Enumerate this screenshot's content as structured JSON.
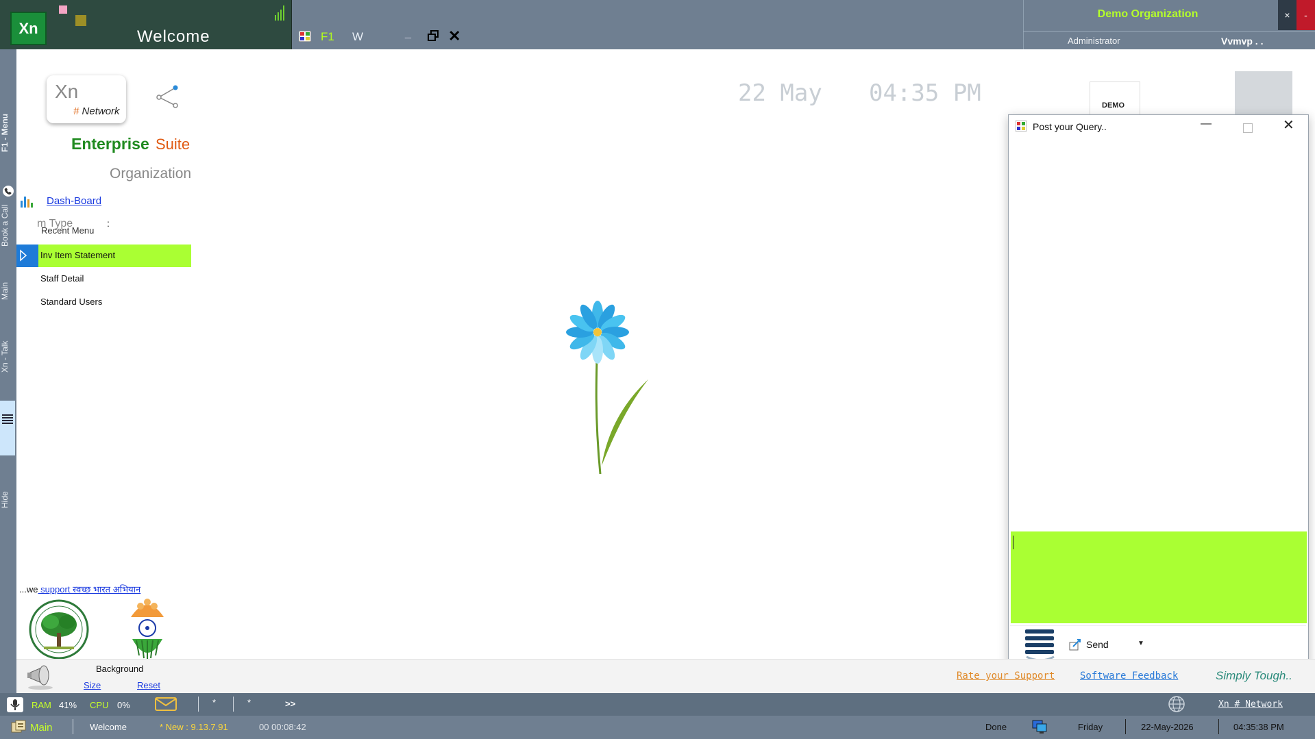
{
  "titlebar": {
    "logo_text": "Xn",
    "title": "Welcome",
    "f1_label": "F1",
    "w_label": "W",
    "min_glyph": "_",
    "close_glyph": "✕"
  },
  "org": {
    "name": "Demo Organization",
    "close_glyph": "×",
    "min_glyph": "-",
    "role": "Administrator",
    "user": "Vvmvp . ."
  },
  "vertical_tabs": {
    "f1_menu": "F1 - Menu",
    "book_call": "Book a Call",
    "main": "Main",
    "xn_talk": "Xn - Talk",
    "hide": "Hide"
  },
  "left_panel": {
    "card_xn": "Xn",
    "card_hash": "#",
    "card_network": "Network",
    "enterprise": "Enterprise",
    "suite": "Suite",
    "organization": "Organization",
    "dashboard": "Dash-Board",
    "type_ghost": "m Type",
    "colon": ":",
    "recent_menu": "Recent Menu",
    "menu_items": [
      "Inv Item Statement",
      "Staff Detail",
      "Standard Users"
    ],
    "swachh_prefix": "...we",
    "swachh_link": " support स्वच्छ भारत अभियान"
  },
  "clock": {
    "date": "22 May",
    "time": "04:35 PM"
  },
  "demo_logo_text": "DEMO",
  "dialog": {
    "title": "Post your Query..",
    "min_glyph": "—",
    "close_glyph": "✕",
    "send_label": "Send",
    "send_caret": "▼"
  },
  "bottom_links": {
    "background": "Background",
    "size": "Size",
    "reset": "Reset",
    "rate": "Rate your Support",
    "feedback": "Software Feedback",
    "tagline": "Simply Tough.."
  },
  "status1": {
    "ram_label": "RAM",
    "ram_value": "41%",
    "cpu_label": "CPU",
    "cpu_value": "0%",
    "star1": "*",
    "star2": "*",
    "more": ">>",
    "xn_network": "Xn # Network"
  },
  "status2": {
    "main": "Main",
    "welcome": "Welcome",
    "version": "* New : 9.13.7.91",
    "elapsed": "00 00:08:42",
    "done": "Done",
    "day": "Friday",
    "date": "22-May-2026",
    "time": "04:35:38 PM"
  },
  "colors": {
    "highlight_green": "#aaff33",
    "brand_green": "#1f8a1f",
    "accent_orange": "#e05a12",
    "chrome_gray": "#6f7f91"
  }
}
